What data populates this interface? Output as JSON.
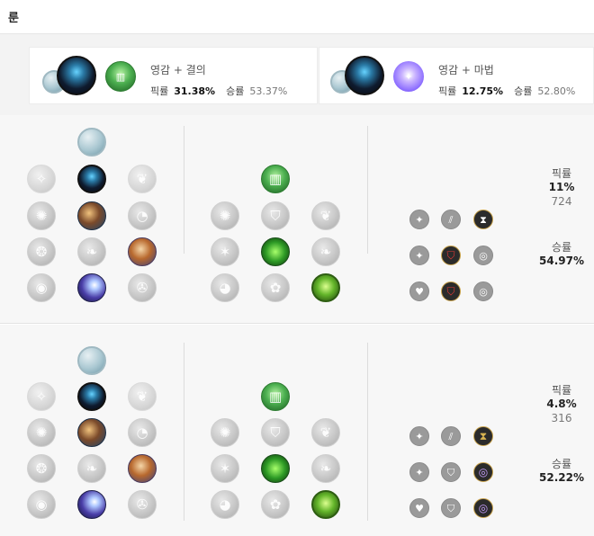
{
  "header": {
    "title": "룬"
  },
  "summary": [
    {
      "title": "영감 + 결의",
      "pick_label": "픽률",
      "pick_value": "31.38%",
      "win_label": "승률",
      "win_value": "53.37%"
    },
    {
      "title": "영감 + 마법",
      "pick_label": "픽률",
      "pick_value": "12.75%",
      "win_label": "승률",
      "win_value": "52.80%"
    }
  ],
  "pages": [
    {
      "pick_label": "픽률",
      "pick_value": "11%",
      "pick_count": "724",
      "win_label": "승률",
      "win_value": "54.97%"
    },
    {
      "pick_label": "픽률",
      "pick_value": "4.8%",
      "pick_count": "316",
      "win_label": "승률",
      "win_value": "52.22%"
    }
  ],
  "icons": {
    "inspiration_tree": "inspiration-stone-icon",
    "keystone": "first-strike-book-icon",
    "resolve_tree": "resolve-shield-icon",
    "sorcery_tree": "sorcery-crystal-icon"
  },
  "colors": {
    "accent_gold": "#c8a24a",
    "shard_red": "#e53935",
    "shard_violet": "#c9a0ff",
    "resolve_green": "#4caf50",
    "sorcery_purple": "#8a6bff"
  }
}
